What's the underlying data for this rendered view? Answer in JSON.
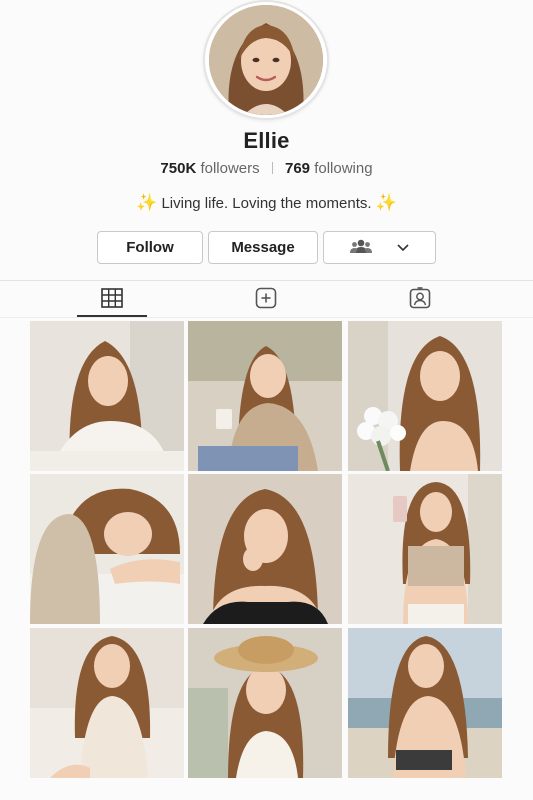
{
  "profile": {
    "name": "Ellie",
    "followers_count": "750K",
    "followers_label": "followers",
    "following_count": "769",
    "following_label": "following",
    "bio_emoji": "✨",
    "bio_text": "Living life. Loving the moments."
  },
  "actions": {
    "follow_label": "Follow",
    "message_label": "Message",
    "more_icon": "people-icon",
    "dropdown_icon": "chevron-down-icon"
  },
  "tabs": [
    {
      "icon": "grid-icon",
      "active": true
    },
    {
      "icon": "reels-icon",
      "active": false
    },
    {
      "icon": "tagged-icon",
      "active": false
    }
  ],
  "posts": [
    {
      "scene": "bed-white-top"
    },
    {
      "scene": "cafe-coffee-blazer"
    },
    {
      "scene": "white-flowers"
    },
    {
      "scene": "lying-sweater"
    },
    {
      "scene": "black-top-portrait"
    },
    {
      "scene": "mirror-selfie"
    },
    {
      "scene": "bed-satin-dress"
    },
    {
      "scene": "straw-hat"
    },
    {
      "scene": "beach"
    }
  ],
  "colors": {
    "accent_sparkle": "#e8b22c",
    "text_primary": "#222222",
    "text_secondary": "#666666"
  }
}
